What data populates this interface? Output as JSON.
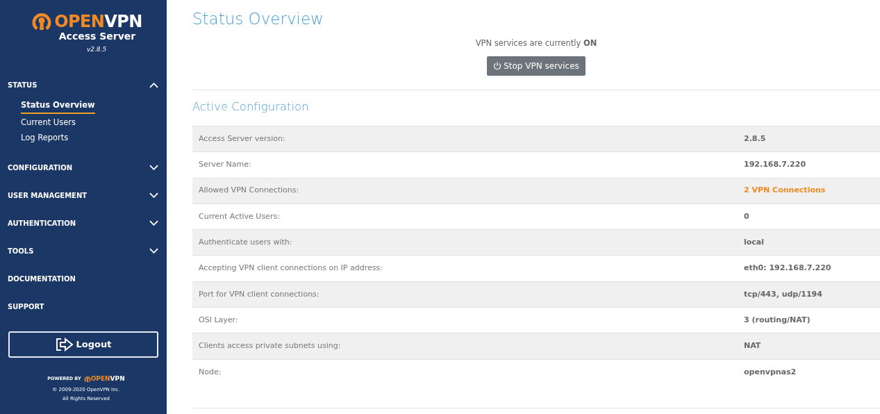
{
  "sidebar": {
    "logo": {
      "brand_part_1": "OPEN",
      "brand_part_2": "VPN",
      "product": "Access Server",
      "version": "v2.8.5"
    },
    "sections": [
      {
        "label": "STATUS",
        "expandable": true,
        "expanded": true,
        "items": [
          {
            "label": "Status Overview",
            "selected": true
          },
          {
            "label": "Current Users",
            "selected": false
          },
          {
            "label": "Log Reports",
            "selected": false
          }
        ]
      },
      {
        "label": "CONFIGURATION",
        "expandable": true,
        "expanded": false
      },
      {
        "label": "USER MANAGEMENT",
        "expandable": true,
        "expanded": false
      },
      {
        "label": "AUTHENTICATION",
        "expandable": true,
        "expanded": false
      },
      {
        "label": "TOOLS",
        "expandable": true,
        "expanded": false
      },
      {
        "label": "DOCUMENTATION",
        "expandable": false
      },
      {
        "label": "SUPPORT",
        "expandable": false
      }
    ],
    "logout_button": "Logout",
    "footer": {
      "powered_by": "POWERED BY",
      "brand_part_1": "OPEN",
      "brand_part_2": "VPN",
      "copyright": "© 2009-2020 OpenVPN Inc.",
      "rights": "All Rights Reserved"
    }
  },
  "main": {
    "title": "Status Overview",
    "service_status": "VPN services are currently **ON**",
    "stop_button": "Stop VPN services",
    "config_title": "Active Configuration",
    "rows": [
      {
        "label": "Access Server version:",
        "value": "2.8.5",
        "kind": "text"
      },
      {
        "label": "Server Name:",
        "value": "192.168.7.220",
        "kind": "text"
      },
      {
        "label": "Allowed VPN Connections:",
        "value": "2 VPN Connections",
        "kind": "link"
      },
      {
        "label": "Current Active Users:",
        "value": "0",
        "kind": "text"
      },
      {
        "label": "Authenticate users with:",
        "value": "local",
        "kind": "text"
      },
      {
        "label": "Accepting VPN client connections on IP address:",
        "value": "eth0: 192.168.7.220",
        "kind": "text"
      },
      {
        "label": "Port for VPN client connections:",
        "value": "tcp/443, udp/1194",
        "kind": "text"
      },
      {
        "label": "OSI Layer:",
        "value": "3 (routing/NAT)",
        "kind": "text"
      },
      {
        "label": "Clients access private subnets using:",
        "value": "NAT",
        "kind": "text"
      },
      {
        "label": "Node:",
        "value": "openvpnas2",
        "kind": "text"
      }
    ]
  }
}
